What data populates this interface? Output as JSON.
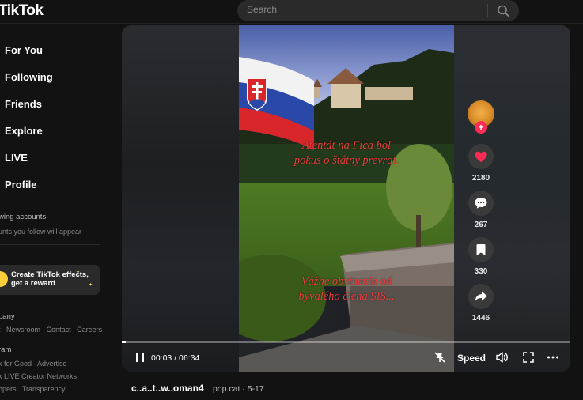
{
  "header": {
    "logo": "TikTok",
    "search_placeholder": "Search"
  },
  "sidebar": {
    "nav": [
      "For You",
      "Following",
      "Friends",
      "Explore",
      "LIVE",
      "Profile"
    ],
    "following_title": "wing accounts",
    "following_text": "unts you follow will appear",
    "effects_line1": "Create TikTok effects,",
    "effects_line2": "get a reward",
    "company_title": "pany",
    "company_links": [
      "t",
      "Newsroom",
      "Contact",
      "Careers"
    ],
    "program_title": "ram",
    "program_row1": [
      "k for Good",
      "Advertise"
    ],
    "program_row2": [
      "k LIVE Creator Networks"
    ],
    "program_row3": [
      "opers",
      "Transparency"
    ]
  },
  "video": {
    "overlay1_line1": "Atentát na Fica bol",
    "overlay1_line2": "pokus o štátny prevrat.",
    "overlay2_line1": "Vážne obvinenia od",
    "overlay2_line2": "bývalého člena SIS..."
  },
  "actions": {
    "likes": "2180",
    "comments": "267",
    "saves": "330",
    "shares": "1446"
  },
  "player": {
    "time": "00:03 / 06:34",
    "progress_fraction": 0.008,
    "speed_label": "Speed"
  },
  "caption": {
    "username": "c..a..t..w..oman4",
    "nickname": "pop cat · 5-17"
  },
  "colors": {
    "accent": "#fe2c55",
    "overlay_text": "#e83c3c"
  }
}
